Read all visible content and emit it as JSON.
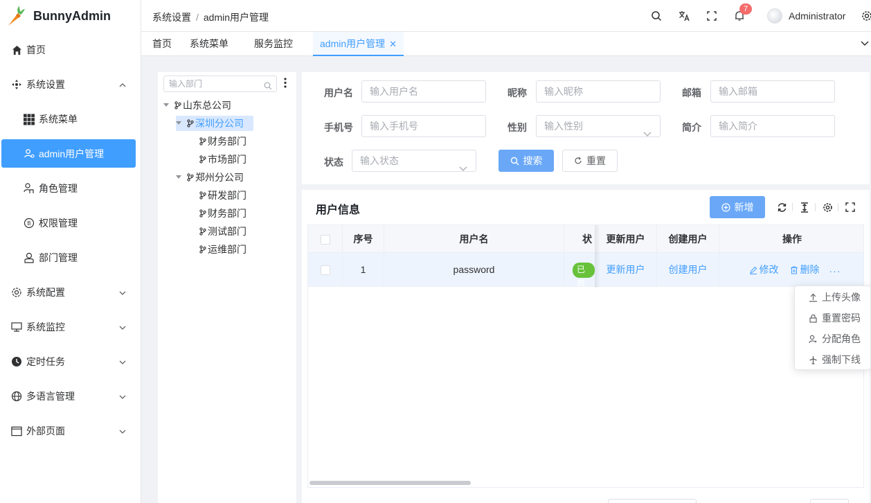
{
  "app": {
    "name": "BunnyAdmin"
  },
  "sidebar": {
    "items": [
      {
        "label": "首页"
      },
      {
        "label": "系统设置"
      },
      {
        "label": "系统菜单"
      },
      {
        "label": "admin用户管理"
      },
      {
        "label": "角色管理"
      },
      {
        "label": "权限管理"
      },
      {
        "label": "部门管理"
      },
      {
        "label": "系统配置"
      },
      {
        "label": "系统监控"
      },
      {
        "label": "定时任务"
      },
      {
        "label": "多语言管理"
      },
      {
        "label": "外部页面"
      }
    ]
  },
  "header": {
    "breadcrumb": [
      "系统设置",
      "admin用户管理"
    ],
    "breadcrumb_sep": "/",
    "notification_count": "7",
    "username": "Administrator"
  },
  "tabs": [
    {
      "label": "首页"
    },
    {
      "label": "系统菜单"
    },
    {
      "label": "服务监控"
    },
    {
      "label": "admin用户管理",
      "active": true
    }
  ],
  "dept_tree": {
    "search_placeholder": "输入部门",
    "nodes": [
      {
        "label": "山东总公司",
        "level": 0,
        "expanded": true
      },
      {
        "label": "深圳分公司",
        "level": 1,
        "expanded": true,
        "selected": true
      },
      {
        "label": "财务部门",
        "level": 2
      },
      {
        "label": "市场部门",
        "level": 2
      },
      {
        "label": "郑州分公司",
        "level": 1,
        "expanded": true
      },
      {
        "label": "研发部门",
        "level": 2
      },
      {
        "label": "财务部门",
        "level": 2
      },
      {
        "label": "测试部门",
        "level": 2
      },
      {
        "label": "运维部门",
        "level": 2
      }
    ]
  },
  "search_form": {
    "fields": [
      {
        "label": "用户名",
        "placeholder": "输入用户名"
      },
      {
        "label": "昵称",
        "placeholder": "输入昵称"
      },
      {
        "label": "邮箱",
        "placeholder": "输入邮箱"
      },
      {
        "label": "手机号",
        "placeholder": "输入手机号"
      },
      {
        "label": "性别",
        "placeholder": "输入性别",
        "type": "select"
      },
      {
        "label": "简介",
        "placeholder": "输入简介"
      },
      {
        "label": "状态",
        "placeholder": "输入状态",
        "type": "select"
      }
    ],
    "search_label": "搜索",
    "reset_label": "重置"
  },
  "table_panel": {
    "title": "用户信息",
    "add_label": "新增",
    "columns": [
      "序号",
      "用户名",
      "状态",
      "更新用户",
      "创建用户",
      "操作"
    ],
    "rows": [
      {
        "index": "1",
        "username": "password",
        "status": "已启用",
        "update_user": "更新用户",
        "create_user": "创建用户",
        "edit": "修改",
        "delete": "删除",
        "more": "···"
      }
    ]
  },
  "more_menu": {
    "items": [
      {
        "label": "上传头像"
      },
      {
        "label": "重置密码"
      },
      {
        "label": "分配角色"
      },
      {
        "label": "强制下线"
      }
    ]
  },
  "colors": {
    "primary": "#409eff",
    "success": "#67c23a",
    "danger": "#f56c6c"
  }
}
